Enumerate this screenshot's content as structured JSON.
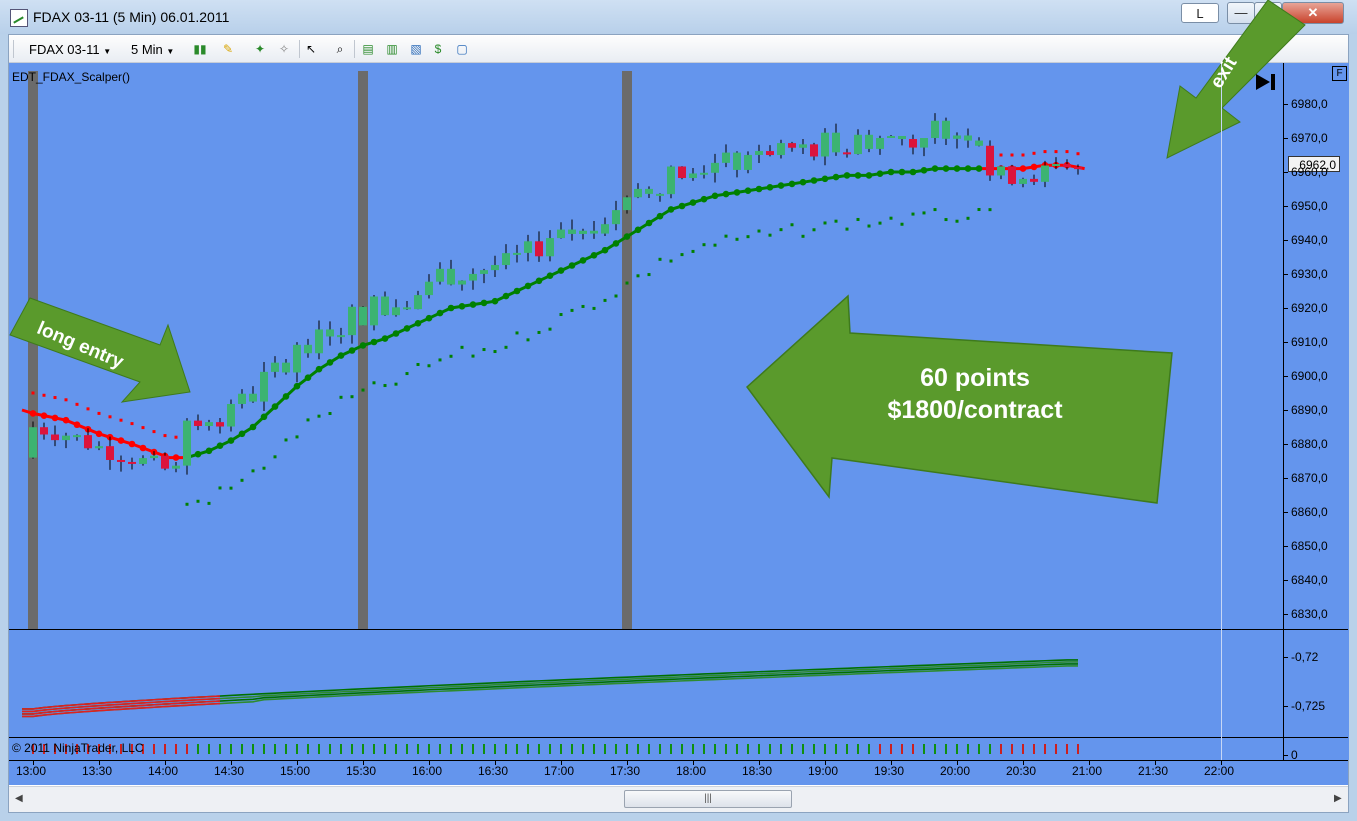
{
  "window": {
    "title": "FDAX 03-11 (5 Min)  06.01.2011",
    "btn_l": "L",
    "btn_min": "—",
    "btn_max": "□",
    "btn_close": "✕"
  },
  "toolbar": {
    "instrument": "FDAX 03-11",
    "interval": "5 Min",
    "icons": [
      "candlestick-icon",
      "pencil-icon",
      "pin-icon",
      "eraser-icon",
      "pointer-icon",
      "zoom-icon",
      "bars-icon",
      "strategy-icon",
      "chart-properties-icon",
      "dollar-icon",
      "window-icon"
    ]
  },
  "chart": {
    "indicator_name": "EDT_FDAX_Scalper()",
    "copyright": "© 2011 NinjaTrader, LLC",
    "current_price": "6962,0",
    "panel_flag": "F",
    "y_labels": [
      "6980,0",
      "6970,0",
      "6960,0",
      "6950,0",
      "6940,0",
      "6930,0",
      "6920,0",
      "6910,0",
      "6900,0",
      "6890,0",
      "6880,0",
      "6870,0",
      "6860,0",
      "6850,0",
      "6840,0",
      "6830,0"
    ],
    "indicator_labels": [
      "-0,72",
      "-0,725"
    ],
    "volume_label": "0",
    "x_labels": [
      "13:00",
      "13:30",
      "14:00",
      "14:30",
      "15:00",
      "15:30",
      "16:00",
      "16:30",
      "17:00",
      "17:30",
      "18:00",
      "18:30",
      "19:00",
      "19:30",
      "20:00",
      "20:30",
      "21:00",
      "21:30",
      "22:00"
    ]
  },
  "annotations": {
    "long_entry": "long entry",
    "exit": "exit",
    "points": "60 points",
    "per_contract": "$1800/contract"
  },
  "colors": {
    "panel_bg": "#6495ed",
    "bull": "#3cb371",
    "bear": "#dc143c",
    "trend_green": "#008000",
    "trend_red": "#ff0000",
    "arrow_green": "#5a9a2c"
  }
}
